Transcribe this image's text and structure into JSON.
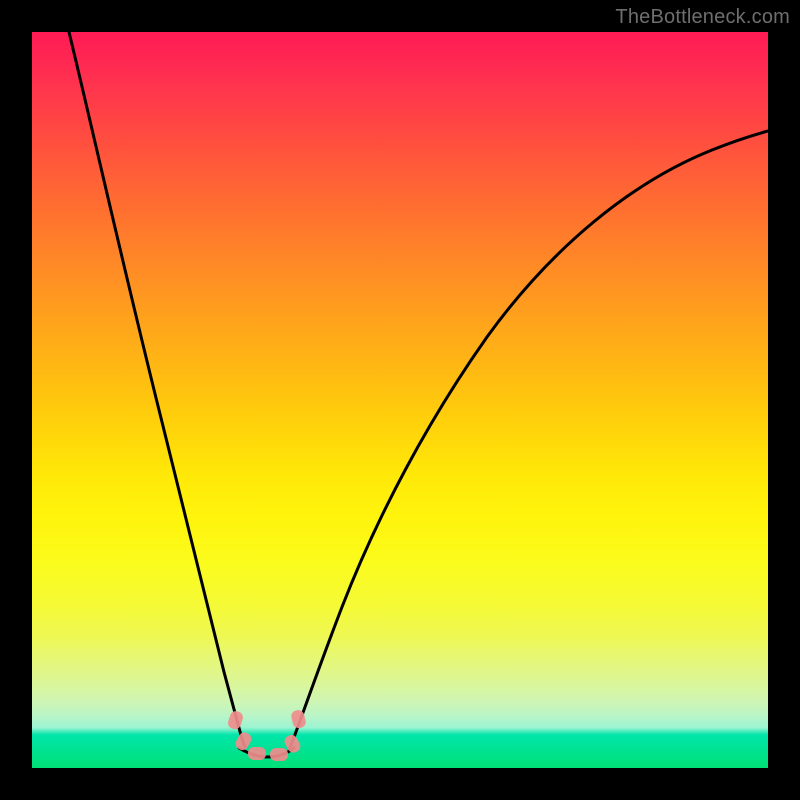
{
  "watermark": "TheBottleneck.com",
  "chart_data": {
    "type": "line",
    "title": "",
    "xlabel": "",
    "ylabel": "",
    "xlim": [
      0,
      100
    ],
    "ylim": [
      0,
      100
    ],
    "grid": false,
    "legend": false,
    "description": "Bottleneck curve with a single minimum where the curve touches the green zone near the bottom. Left branch descends steeply from top-left; right branch rises toward the upper-right. Background gradient red (high bottleneck) → green (optimal).",
    "series": [
      {
        "name": "left-branch",
        "x": [
          5,
          8,
          11,
          14,
          17,
          20,
          22,
          24,
          25.5,
          26.5,
          27.3,
          27.8
        ],
        "values": [
          100,
          88,
          76,
          64,
          52,
          40,
          30,
          20,
          12,
          7,
          4,
          2
        ]
      },
      {
        "name": "right-branch",
        "x": [
          33,
          33.8,
          35,
          37,
          40,
          45,
          51,
          58,
          66,
          75,
          85,
          95,
          100
        ],
        "values": [
          2,
          5,
          9,
          15,
          24,
          36,
          48,
          58,
          67,
          74,
          80,
          84,
          86
        ]
      },
      {
        "name": "optimal-floor",
        "x": [
          27.8,
          29,
          30,
          31,
          32,
          33
        ],
        "values": [
          2,
          1.3,
          1.0,
          1.0,
          1.3,
          2
        ]
      }
    ],
    "markers": [
      {
        "x": 26.5,
        "y": 5.5
      },
      {
        "x": 27.5,
        "y": 3.2
      },
      {
        "x": 29.0,
        "y": 1.6
      },
      {
        "x": 31.2,
        "y": 1.4
      },
      {
        "x": 33.0,
        "y": 2.6
      },
      {
        "x": 34.2,
        "y": 6.2
      }
    ],
    "background_gradient": {
      "top": "#ff1a55",
      "mid": "#ffe808",
      "bottom": "#00e076"
    }
  }
}
